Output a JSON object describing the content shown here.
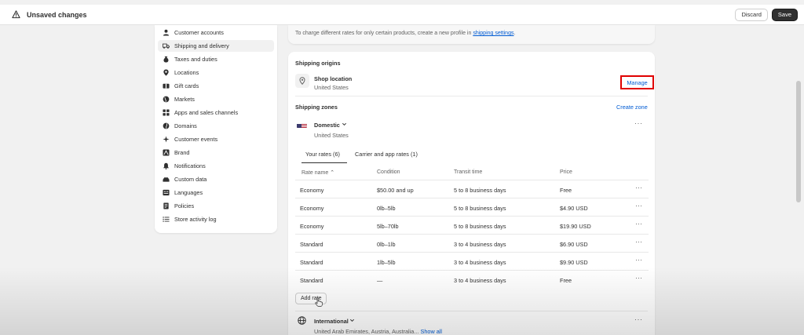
{
  "topbar": {
    "title": "Unsaved changes",
    "discard_label": "Discard",
    "save_label": "Save"
  },
  "sidebar": {
    "items": [
      {
        "label": "Customer accounts",
        "icon": "person-icon"
      },
      {
        "label": "Shipping and delivery",
        "icon": "truck-icon",
        "active": true
      },
      {
        "label": "Taxes and duties",
        "icon": "money-bag-icon"
      },
      {
        "label": "Locations",
        "icon": "location-pin-icon"
      },
      {
        "label": "Gift cards",
        "icon": "gift-card-icon"
      },
      {
        "label": "Markets",
        "icon": "globe-icon"
      },
      {
        "label": "Apps and sales channels",
        "icon": "apps-icon"
      },
      {
        "label": "Domains",
        "icon": "globe-icon"
      },
      {
        "label": "Customer events",
        "icon": "sparkle-icon"
      },
      {
        "label": "Brand",
        "icon": "brand-icon"
      },
      {
        "label": "Notifications",
        "icon": "bell-icon"
      },
      {
        "label": "Custom data",
        "icon": "database-icon"
      },
      {
        "label": "Languages",
        "icon": "language-icon"
      },
      {
        "label": "Policies",
        "icon": "document-icon"
      },
      {
        "label": "Store activity log",
        "icon": "list-icon"
      }
    ]
  },
  "profile_note": {
    "text": "To charge different rates for only certain products, create a new profile in ",
    "link": "shipping settings",
    "suffix": "."
  },
  "shipping_origins": {
    "title": "Shipping origins",
    "location_name": "Shop location",
    "location_country": "United States",
    "manage_label": "Manage"
  },
  "shipping_zones": {
    "title": "Shipping zones",
    "create_label": "Create zone",
    "domestic": {
      "name": "Domestic",
      "country": "United States"
    },
    "tabs": [
      {
        "label": "Your rates (6)",
        "active": true
      },
      {
        "label": "Carrier and app rates (1)",
        "active": false
      }
    ],
    "columns": [
      "Rate name",
      "Condition",
      "Transit time",
      "Price"
    ],
    "rows": [
      {
        "name": "Economy",
        "condition": "$50.00 and up",
        "transit": "5 to 8 business days",
        "price": "Free"
      },
      {
        "name": "Economy",
        "condition": "0lb–5lb",
        "transit": "5 to 8 business days",
        "price": "$4.90 USD"
      },
      {
        "name": "Economy",
        "condition": "5lb–70lb",
        "transit": "5 to 8 business days",
        "price": "$19.90 USD"
      },
      {
        "name": "Standard",
        "condition": "0lb–1lb",
        "transit": "3 to 4 business days",
        "price": "$6.90 USD"
      },
      {
        "name": "Standard",
        "condition": "1lb–5lb",
        "transit": "3 to 4 business days",
        "price": "$9.90 USD"
      },
      {
        "name": "Standard",
        "condition": "—",
        "transit": "3 to 4 business days",
        "price": "Free"
      }
    ],
    "add_rate_label": "Add rate",
    "international": {
      "name": "International",
      "countries": "United Arab Emirates, Austria, Australia...",
      "show_all_label": "Show all"
    }
  },
  "colors": {
    "accent_link": "#005bd3",
    "highlight_border": "#e00000",
    "save_button": "#303030"
  }
}
